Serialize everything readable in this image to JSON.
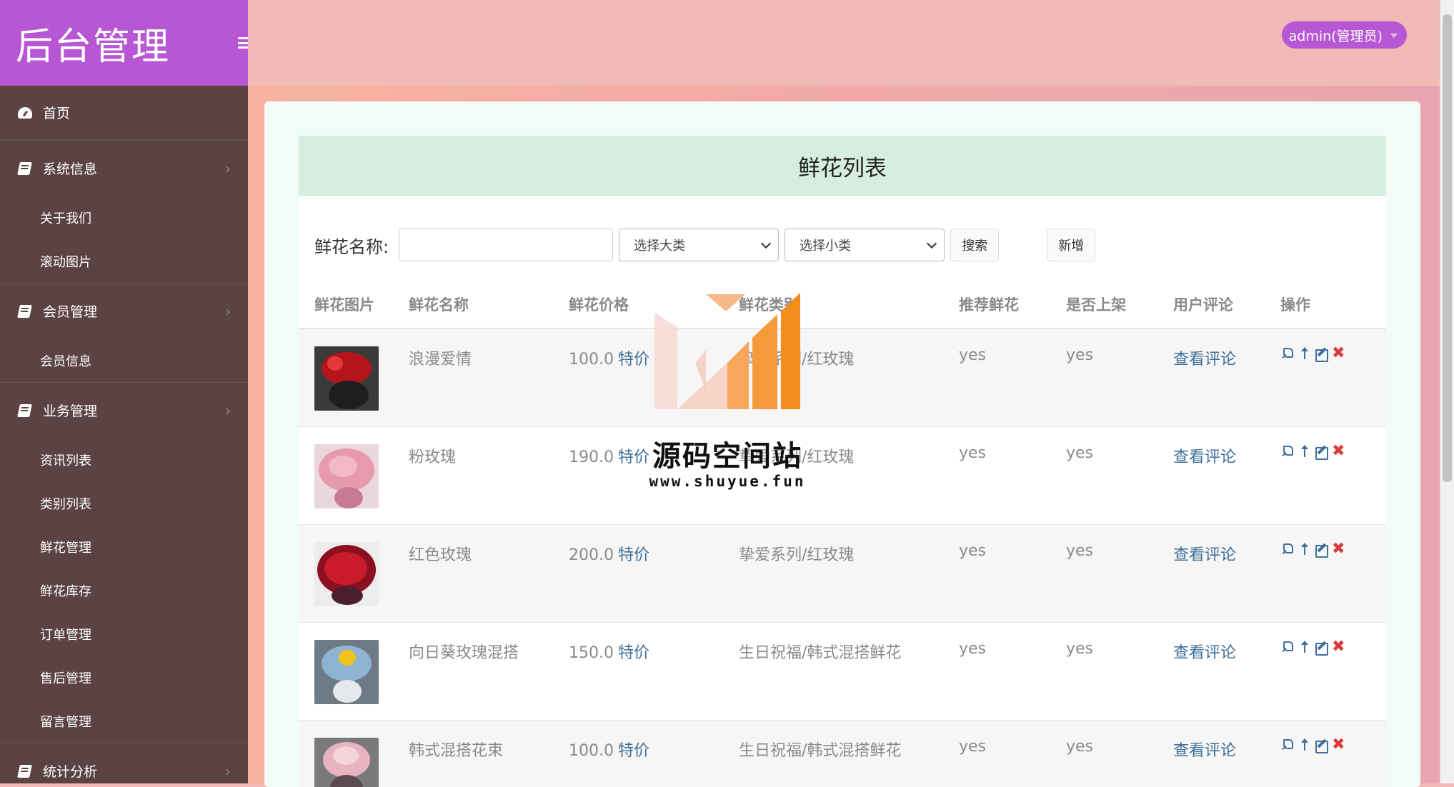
{
  "sidebar": {
    "brand": "后台管理",
    "home": "首页",
    "groups": [
      {
        "label": "系统信息",
        "items": [
          "关于我们",
          "滚动图片"
        ]
      },
      {
        "label": "会员管理",
        "items": [
          "会员信息"
        ]
      },
      {
        "label": "业务管理",
        "items": [
          "资讯列表",
          "类别列表",
          "鲜花管理",
          "鲜花库存",
          "订单管理",
          "售后管理",
          "留言管理"
        ]
      },
      {
        "label": "统计分析",
        "items": []
      }
    ]
  },
  "header": {
    "user": "admin(管理员)"
  },
  "page": {
    "title": "鲜花列表",
    "search": {
      "label": "鲜花名称:",
      "value": "",
      "category_placeholder": "选择大类",
      "subcategory_placeholder": "选择小类",
      "search_btn": "搜索",
      "add_btn": "新增"
    },
    "columns": [
      "鲜花图片",
      "鲜花名称",
      "鲜花价格",
      "鲜花类别",
      "推荐鲜花",
      "是否上架",
      "用户评论",
      "操作"
    ],
    "rows": [
      {
        "name": "浪漫爱情",
        "price": "100.0",
        "tag": "特价",
        "category": "挚爱系列/红玫瑰",
        "recommend": "yes",
        "on_sale": "yes",
        "comment_link": "查看评论"
      },
      {
        "name": "粉玫瑰",
        "price": "190.0",
        "tag": "特价",
        "category": "挚爱系列/红玫瑰",
        "recommend": "yes",
        "on_sale": "yes",
        "comment_link": "查看评论"
      },
      {
        "name": "红色玫瑰",
        "price": "200.0",
        "tag": "特价",
        "category": "挚爱系列/红玫瑰",
        "recommend": "yes",
        "on_sale": "yes",
        "comment_link": "查看评论"
      },
      {
        "name": "向日葵玫瑰混搭",
        "price": "150.0",
        "tag": "特价",
        "category": "生日祝福/韩式混搭鲜花",
        "recommend": "yes",
        "on_sale": "yes",
        "comment_link": "查看评论"
      },
      {
        "name": "韩式混搭花束",
        "price": "100.0",
        "tag": "特价",
        "category": "生日祝福/韩式混搭鲜花",
        "recommend": "yes",
        "on_sale": "yes",
        "comment_link": "查看评论"
      }
    ],
    "ops_delete_glyph": "✖"
  },
  "watermark": {
    "title": "源码空间站",
    "url": "www.shuyue.fun"
  },
  "colors": {
    "brand_purple": "#b757d4",
    "sidebar_bg": "#5c4343",
    "link_blue": "#3f6f9a",
    "delete_red": "#d83b3b",
    "title_bar": "#d6eedf"
  }
}
